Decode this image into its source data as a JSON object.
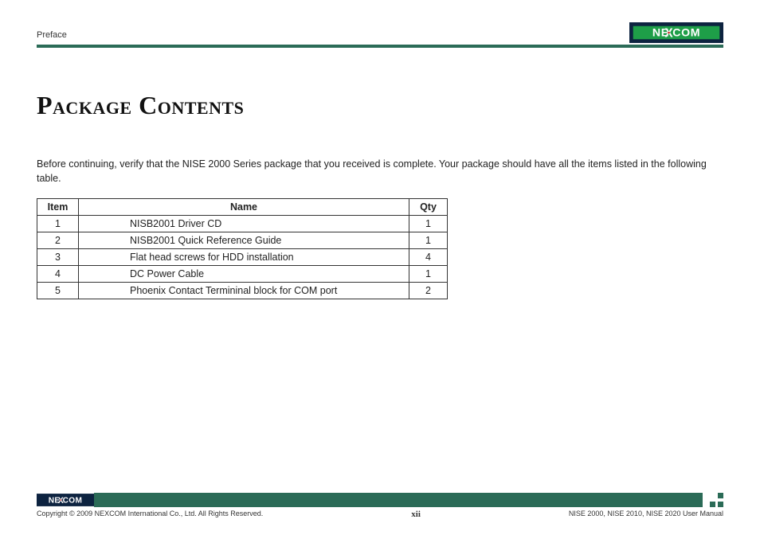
{
  "header": {
    "section": "Preface",
    "logo_text": "NEXCOM"
  },
  "title": "Package Contents",
  "intro": "Before continuing, verify that the NISE 2000 Series package that you received is complete. Your package should have all the items listed in the following table.",
  "table": {
    "headers": {
      "item": "Item",
      "name": "Name",
      "qty": "Qty"
    },
    "rows": [
      {
        "item": "1",
        "name": "NISB2001 Driver CD",
        "qty": "1"
      },
      {
        "item": "2",
        "name": "NISB2001 Quick Reference Guide",
        "qty": "1"
      },
      {
        "item": "3",
        "name": "Flat head screws for HDD installation",
        "qty": "4"
      },
      {
        "item": "4",
        "name": "DC Power Cable",
        "qty": "1"
      },
      {
        "item": "5",
        "name": "Phoenix Contact Termininal block for COM port",
        "qty": "2"
      }
    ]
  },
  "footer": {
    "logo_text": "NEXCOM",
    "copyright": "Copyright © 2009 NEXCOM International Co., Ltd. All Rights Reserved.",
    "page_number": "xii",
    "manual_ref": "NISE 2000, NISE 2010, NISE 2020 User Manual"
  },
  "colors": {
    "brand_green": "#2b6b57",
    "logo_green": "#1e9e48",
    "logo_navy": "#0d2340"
  }
}
